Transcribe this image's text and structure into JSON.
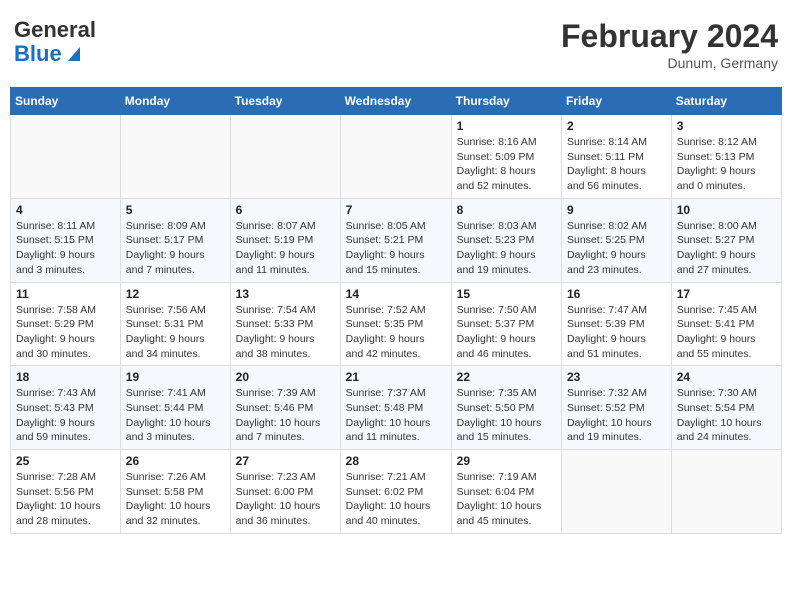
{
  "header": {
    "logo_general": "General",
    "logo_blue": "Blue",
    "month_title": "February 2024",
    "location": "Dunum, Germany"
  },
  "weekdays": [
    "Sunday",
    "Monday",
    "Tuesday",
    "Wednesday",
    "Thursday",
    "Friday",
    "Saturday"
  ],
  "weeks": [
    [
      {
        "day": "",
        "info": ""
      },
      {
        "day": "",
        "info": ""
      },
      {
        "day": "",
        "info": ""
      },
      {
        "day": "",
        "info": ""
      },
      {
        "day": "1",
        "info": "Sunrise: 8:16 AM\nSunset: 5:09 PM\nDaylight: 8 hours\nand 52 minutes."
      },
      {
        "day": "2",
        "info": "Sunrise: 8:14 AM\nSunset: 5:11 PM\nDaylight: 8 hours\nand 56 minutes."
      },
      {
        "day": "3",
        "info": "Sunrise: 8:12 AM\nSunset: 5:13 PM\nDaylight: 9 hours\nand 0 minutes."
      }
    ],
    [
      {
        "day": "4",
        "info": "Sunrise: 8:11 AM\nSunset: 5:15 PM\nDaylight: 9 hours\nand 3 minutes."
      },
      {
        "day": "5",
        "info": "Sunrise: 8:09 AM\nSunset: 5:17 PM\nDaylight: 9 hours\nand 7 minutes."
      },
      {
        "day": "6",
        "info": "Sunrise: 8:07 AM\nSunset: 5:19 PM\nDaylight: 9 hours\nand 11 minutes."
      },
      {
        "day": "7",
        "info": "Sunrise: 8:05 AM\nSunset: 5:21 PM\nDaylight: 9 hours\nand 15 minutes."
      },
      {
        "day": "8",
        "info": "Sunrise: 8:03 AM\nSunset: 5:23 PM\nDaylight: 9 hours\nand 19 minutes."
      },
      {
        "day": "9",
        "info": "Sunrise: 8:02 AM\nSunset: 5:25 PM\nDaylight: 9 hours\nand 23 minutes."
      },
      {
        "day": "10",
        "info": "Sunrise: 8:00 AM\nSunset: 5:27 PM\nDaylight: 9 hours\nand 27 minutes."
      }
    ],
    [
      {
        "day": "11",
        "info": "Sunrise: 7:58 AM\nSunset: 5:29 PM\nDaylight: 9 hours\nand 30 minutes."
      },
      {
        "day": "12",
        "info": "Sunrise: 7:56 AM\nSunset: 5:31 PM\nDaylight: 9 hours\nand 34 minutes."
      },
      {
        "day": "13",
        "info": "Sunrise: 7:54 AM\nSunset: 5:33 PM\nDaylight: 9 hours\nand 38 minutes."
      },
      {
        "day": "14",
        "info": "Sunrise: 7:52 AM\nSunset: 5:35 PM\nDaylight: 9 hours\nand 42 minutes."
      },
      {
        "day": "15",
        "info": "Sunrise: 7:50 AM\nSunset: 5:37 PM\nDaylight: 9 hours\nand 46 minutes."
      },
      {
        "day": "16",
        "info": "Sunrise: 7:47 AM\nSunset: 5:39 PM\nDaylight: 9 hours\nand 51 minutes."
      },
      {
        "day": "17",
        "info": "Sunrise: 7:45 AM\nSunset: 5:41 PM\nDaylight: 9 hours\nand 55 minutes."
      }
    ],
    [
      {
        "day": "18",
        "info": "Sunrise: 7:43 AM\nSunset: 5:43 PM\nDaylight: 9 hours\nand 59 minutes."
      },
      {
        "day": "19",
        "info": "Sunrise: 7:41 AM\nSunset: 5:44 PM\nDaylight: 10 hours\nand 3 minutes."
      },
      {
        "day": "20",
        "info": "Sunrise: 7:39 AM\nSunset: 5:46 PM\nDaylight: 10 hours\nand 7 minutes."
      },
      {
        "day": "21",
        "info": "Sunrise: 7:37 AM\nSunset: 5:48 PM\nDaylight: 10 hours\nand 11 minutes."
      },
      {
        "day": "22",
        "info": "Sunrise: 7:35 AM\nSunset: 5:50 PM\nDaylight: 10 hours\nand 15 minutes."
      },
      {
        "day": "23",
        "info": "Sunrise: 7:32 AM\nSunset: 5:52 PM\nDaylight: 10 hours\nand 19 minutes."
      },
      {
        "day": "24",
        "info": "Sunrise: 7:30 AM\nSunset: 5:54 PM\nDaylight: 10 hours\nand 24 minutes."
      }
    ],
    [
      {
        "day": "25",
        "info": "Sunrise: 7:28 AM\nSunset: 5:56 PM\nDaylight: 10 hours\nand 28 minutes."
      },
      {
        "day": "26",
        "info": "Sunrise: 7:26 AM\nSunset: 5:58 PM\nDaylight: 10 hours\nand 32 minutes."
      },
      {
        "day": "27",
        "info": "Sunrise: 7:23 AM\nSunset: 6:00 PM\nDaylight: 10 hours\nand 36 minutes."
      },
      {
        "day": "28",
        "info": "Sunrise: 7:21 AM\nSunset: 6:02 PM\nDaylight: 10 hours\nand 40 minutes."
      },
      {
        "day": "29",
        "info": "Sunrise: 7:19 AM\nSunset: 6:04 PM\nDaylight: 10 hours\nand 45 minutes."
      },
      {
        "day": "",
        "info": ""
      },
      {
        "day": "",
        "info": ""
      }
    ]
  ]
}
